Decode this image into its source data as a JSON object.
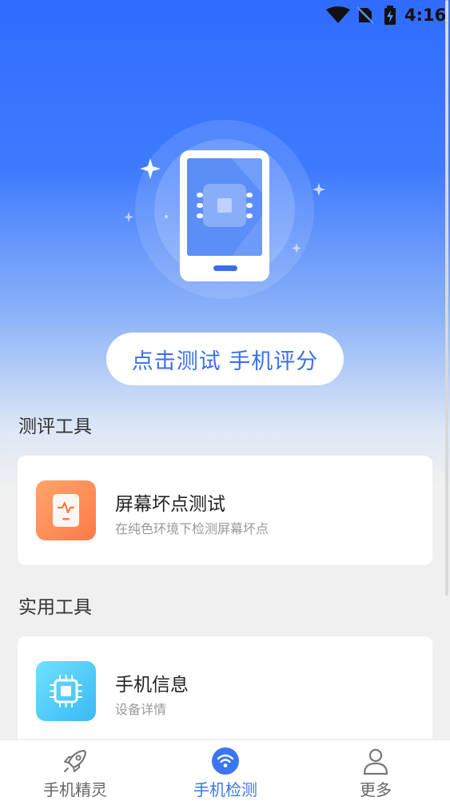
{
  "status": {
    "time": "4:16",
    "icons": [
      "wifi-icon",
      "no-sim-icon",
      "battery-charging-icon"
    ]
  },
  "hero": {
    "illustration": "phone-chip-icon",
    "test_button_label": "点击测试 手机评分"
  },
  "sections": {
    "evaluation_title": "测评工具",
    "utility_title": "实用工具"
  },
  "cards": [
    {
      "title": "屏幕坏点测试",
      "subtitle": "在纯色环境下检测屏幕坏点",
      "icon": "screen-pulse-icon",
      "color": "#ff8a54"
    },
    {
      "title": "手机信息",
      "subtitle": "设备详情",
      "icon": "chip-icon",
      "color": "#4fc8f8"
    }
  ],
  "bottom_nav": {
    "items": [
      {
        "label": "手机精灵",
        "icon": "rocket-icon",
        "active": false
      },
      {
        "label": "手机检测",
        "icon": "wifi-signal-icon",
        "active": true
      },
      {
        "label": "更多",
        "icon": "user-icon",
        "active": false
      }
    ],
    "active_color": "#3a76ef"
  }
}
